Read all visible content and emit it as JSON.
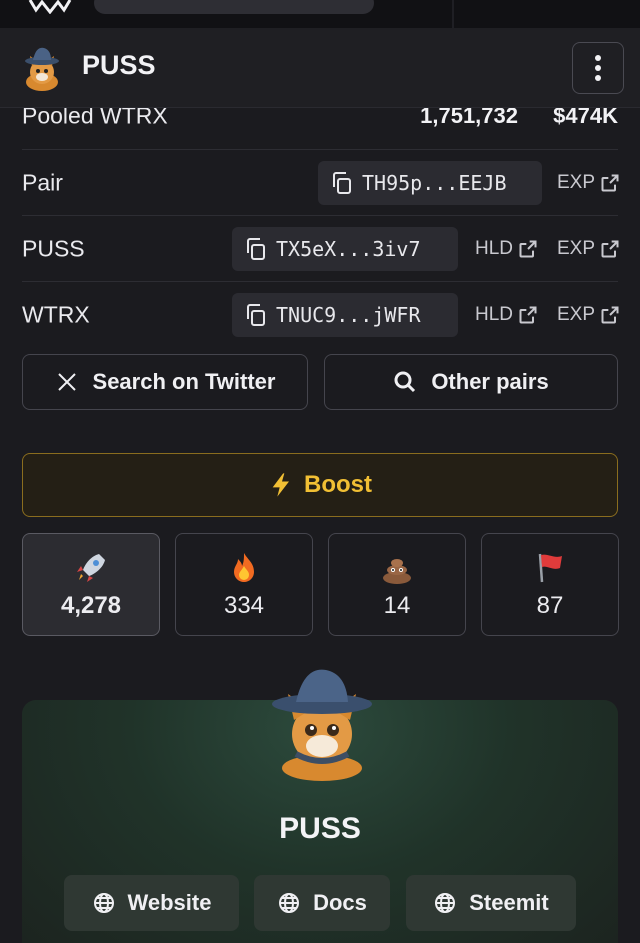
{
  "header": {
    "title": "PUSS",
    "menu_icon": "kebab-menu-icon"
  },
  "pooled": {
    "label": "Pooled WTRX",
    "amount": "1,751,732",
    "usd": "$474K"
  },
  "rows": [
    {
      "label": "Pair",
      "address": "TH95p...EEJB",
      "links": [
        "EXP"
      ]
    },
    {
      "label": "PUSS",
      "address": "TX5eX...3iv7",
      "links": [
        "HLD",
        "EXP"
      ]
    },
    {
      "label": "WTRX",
      "address": "TNUC9...jWFR",
      "links": [
        "HLD",
        "EXP"
      ]
    }
  ],
  "actions": {
    "twitter": "Search on Twitter",
    "other_pairs": "Other pairs"
  },
  "boost": {
    "label": "Boost",
    "accent": "#f1bf34"
  },
  "reactions": [
    {
      "icon": "rocket-icon",
      "count": "4,278"
    },
    {
      "icon": "fire-icon",
      "count": "334"
    },
    {
      "icon": "poop-icon",
      "count": "14"
    },
    {
      "icon": "red-flag-icon",
      "count": "87"
    }
  ],
  "token_card": {
    "name": "PUSS"
  },
  "socials": [
    {
      "icon": "globe-icon",
      "label": "Website"
    },
    {
      "icon": "globe-icon",
      "label": "Docs"
    },
    {
      "icon": "globe-icon",
      "label": "Steemit"
    }
  ]
}
